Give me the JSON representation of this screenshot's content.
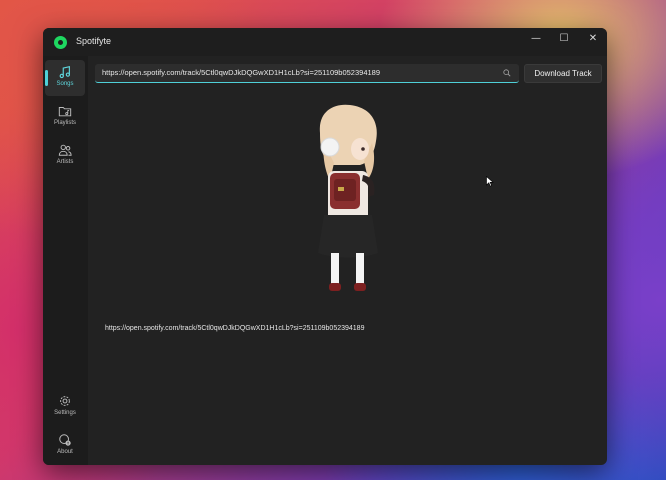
{
  "app": {
    "title": "Spotifyte"
  },
  "window_controls": {
    "minimize": "—",
    "maximize": "☐",
    "close": "✕"
  },
  "sidebar": {
    "items": [
      {
        "label": "Songs",
        "icon": "music-note-icon",
        "active": true
      },
      {
        "label": "Playlists",
        "icon": "folder-music-icon",
        "active": false
      },
      {
        "label": "Artists",
        "icon": "people-icon",
        "active": false
      }
    ],
    "bottom_items": [
      {
        "label": "Settings",
        "icon": "gear-icon"
      },
      {
        "label": "About",
        "icon": "about-icon"
      }
    ]
  },
  "search": {
    "value": "https://open.spotify.com/track/5Ctl0qwDJkDQGwXD1H1cLb?si=251109b052394189"
  },
  "toolbar": {
    "download_label": "Download Track"
  },
  "result": {
    "url": "https://open.spotify.com/track/5Ctl0qwDJkDQGwXD1H1cLb?si=251109b052394189"
  },
  "colors": {
    "accent": "#4fd0d8",
    "brand": "#1ed760",
    "window_bg": "#222222",
    "sidebar_bg": "#1c1c1c"
  }
}
